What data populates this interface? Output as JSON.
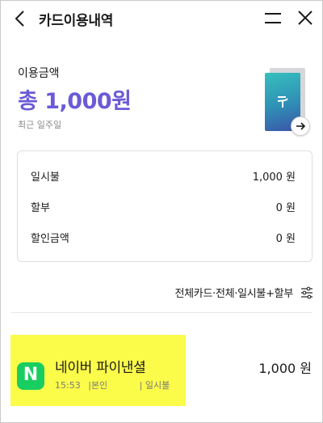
{
  "header": {
    "title": "카드이용내역"
  },
  "usage": {
    "label": "이용금액",
    "total": "총 1,000원",
    "period": "최근 일주일"
  },
  "summary": [
    {
      "label": "일시불",
      "value": "1,000 원"
    },
    {
      "label": "할부",
      "value": "0 원"
    },
    {
      "label": "할인금액",
      "value": "0 원"
    }
  ],
  "filter": {
    "text": "전체카드·전체·일시불+할부"
  },
  "transactions": [
    {
      "logo_letter": "N",
      "merchant": "네이버 파이낸셜",
      "time": "15:53",
      "owner": "|본인",
      "type": "| 일시불",
      "amount": "1,000 원"
    }
  ],
  "colors": {
    "accent": "#6b5bd6",
    "highlight": "#fbfb4a",
    "naver_green": "#19ce60"
  }
}
